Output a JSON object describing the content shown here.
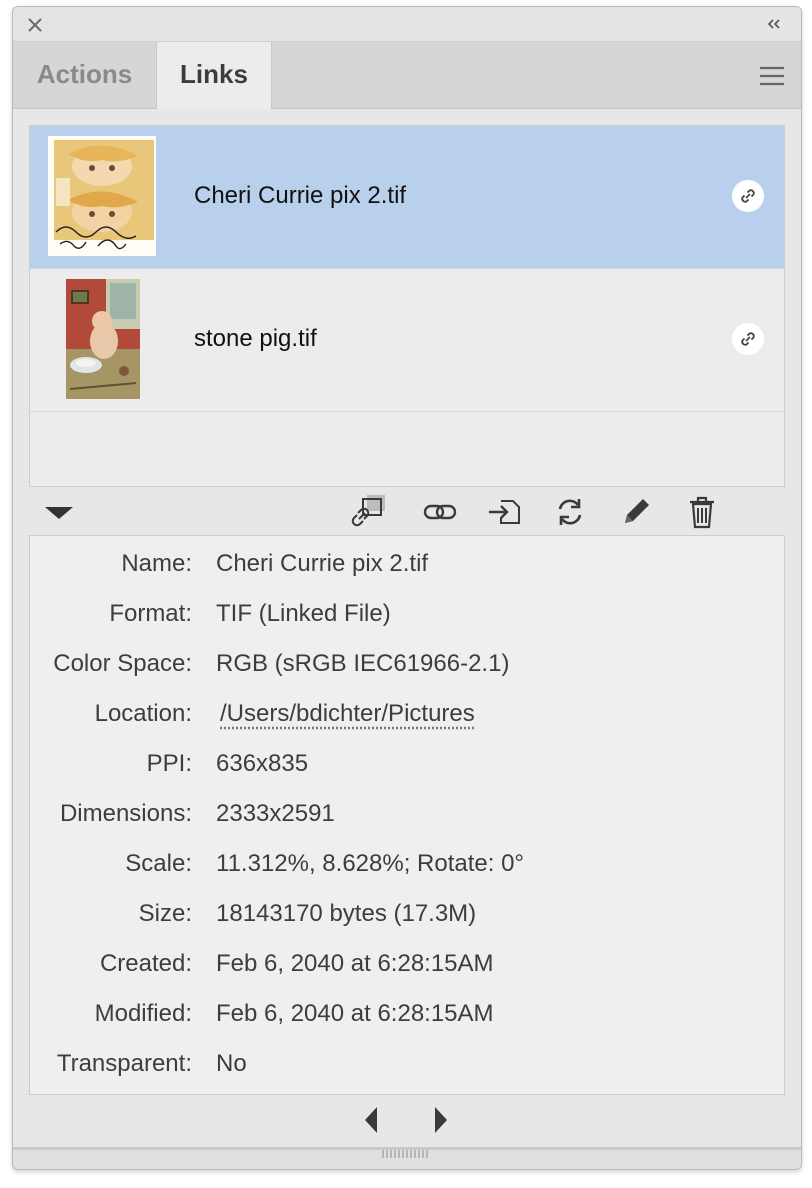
{
  "window": {
    "close_icon": "close-icon",
    "collapse_icon": "double-chevron-left-icon"
  },
  "tabs": [
    {
      "label": "Actions",
      "active": false
    },
    {
      "label": "Links",
      "active": true
    }
  ],
  "panel_menu_icon": "hamburger-menu-icon",
  "links": [
    {
      "name": "Cheri Currie pix 2.tif",
      "selected": true,
      "thumbnail": "photo-thumbnail",
      "status_icon": "link-icon"
    },
    {
      "name": "stone pig.tif",
      "selected": false,
      "thumbnail": "painting-thumbnail",
      "status_icon": "link-icon"
    }
  ],
  "toolbar": {
    "disclosure_icon": "triangle-down-icon",
    "buttons": [
      {
        "name": "relink-from-library",
        "icon": "relink-library-icon"
      },
      {
        "name": "relink",
        "icon": "chain-link-icon"
      },
      {
        "name": "go-to-link",
        "icon": "go-to-link-icon"
      },
      {
        "name": "update-link",
        "icon": "refresh-icon"
      },
      {
        "name": "edit-original",
        "icon": "pencil-icon"
      },
      {
        "name": "delete",
        "icon": "trash-icon"
      }
    ]
  },
  "info": [
    {
      "label": "Name:",
      "value": "Cheri Currie pix 2.tif"
    },
    {
      "label": "Format:",
      "value": "TIF (Linked File)"
    },
    {
      "label": "Color Space:",
      "value": "RGB (sRGB IEC61966-2.1)"
    },
    {
      "label": "Location:",
      "value": "/Users/bdichter/Pictures"
    },
    {
      "label": "PPI:",
      "value": "636x835"
    },
    {
      "label": "Dimensions:",
      "value": "2333x2591"
    },
    {
      "label": "Scale:",
      "value": "11.312%, 8.628%; Rotate: 0°"
    },
    {
      "label": "Size:",
      "value": "18143170 bytes (17.3M)"
    },
    {
      "label": "Created:",
      "value": "Feb 6, 2040 at 6:28:15AM"
    },
    {
      "label": "Modified:",
      "value": "Feb 6, 2040 at 6:28:15AM"
    },
    {
      "label": "Transparent:",
      "value": "No"
    }
  ],
  "nav": {
    "prev_icon": "triangle-left-icon",
    "next_icon": "triangle-right-icon"
  },
  "colors": {
    "selected_row": "#b8d0ec",
    "panel_bg": "#e7e7e7",
    "icon": "#3a3a3a"
  }
}
